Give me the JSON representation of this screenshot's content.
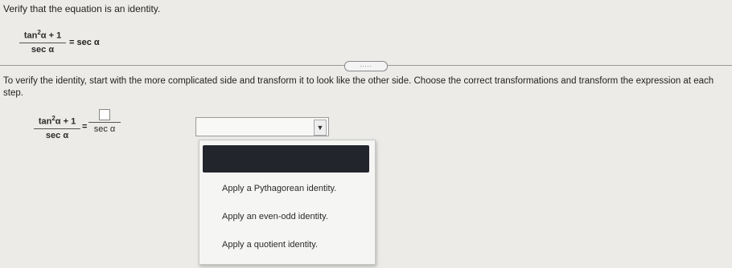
{
  "prompt": "Verify that the equation is an identity.",
  "equation": {
    "numerator": "tan α + 1",
    "numerator_base": "tan",
    "numerator_exp": "2",
    "numerator_rest": "α + 1",
    "denominator": "sec α",
    "rhs": "= sec α"
  },
  "more_button": ".....",
  "instructions": "To verify the identity, start with the more complicated side and transform it to look like the other side. Choose the correct transformations and transform the expression at each step.",
  "step": {
    "lhs_numerator_base": "tan",
    "lhs_numerator_exp": "2",
    "lhs_numerator_rest": "α + 1",
    "lhs_denominator": "sec α",
    "equals": "=",
    "rhs_denominator": "sec α"
  },
  "select": {
    "value": "",
    "arrow_icon": "▼"
  },
  "dropdown": {
    "options": [
      "Apply a Pythagorean identity.",
      "Apply an even-odd identity.",
      "Apply a quotient identity."
    ]
  }
}
